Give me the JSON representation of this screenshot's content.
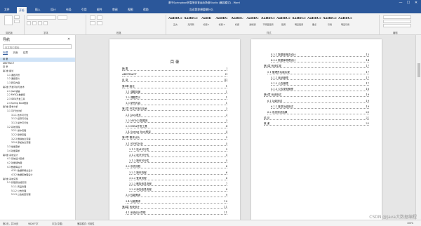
{
  "window": {
    "title": "基于Springboot的智慧体育运动场馆Studio (兼容模式) - Word",
    "controls": [
      "—",
      "☐",
      "✕"
    ]
  },
  "tabs": [
    "文件",
    "开始",
    "插入",
    "设计",
    "布局",
    "引用",
    "邮件",
    "审阅",
    "视图",
    "帮助"
  ],
  "tell_me": "告诉我你想要做什么",
  "ribbon": {
    "groups": [
      "剪贴板",
      "字体",
      "段落",
      "样式",
      "编辑"
    ],
    "styles": [
      {
        "sample": "AaBbCcI",
        "name": "正文"
      },
      {
        "sample": "AaBbCcI",
        "name": "无间隔"
      },
      {
        "sample": "AaBb",
        "name": "标题 1"
      },
      {
        "sample": "AaBbC",
        "name": "标题 2"
      },
      {
        "sample": "AaBbC",
        "name": "标题"
      },
      {
        "sample": "AaBbC",
        "name": "副标题"
      },
      {
        "sample": "AaBbCcD",
        "name": "不明显强调"
      },
      {
        "sample": "AaBbCcD",
        "name": "强调"
      },
      {
        "sample": "AaBbCcD",
        "name": "明显强调"
      },
      {
        "sample": "AaBbCcI",
        "name": "要点"
      },
      {
        "sample": "AaBbCcI",
        "name": "引用"
      },
      {
        "sample": "AaBbCcI",
        "name": "明显引用"
      }
    ]
  },
  "nav": {
    "title": "导航",
    "search_placeholder": "在文档中搜索",
    "tabs": [
      "标题",
      "页面",
      "结果"
    ],
    "items": [
      {
        "text": "摘 要",
        "indent": 0
      },
      {
        "text": "ABSTRACT",
        "indent": 0
      },
      {
        "text": "目 录",
        "indent": 0
      },
      {
        "text": "第1章 绪论",
        "indent": 0
      },
      {
        "text": "1.1 课题背景",
        "indent": 1
      },
      {
        "text": "1.2 课题意义",
        "indent": 1
      },
      {
        "text": "1.3 研究内容",
        "indent": 1
      },
      {
        "text": "第2章 开发环境与技术",
        "indent": 0
      },
      {
        "text": "2.1 Java语言",
        "indent": 1
      },
      {
        "text": "2.2 MYSQL数据库",
        "indent": 1
      },
      {
        "text": "2.3 IDEA开发工具",
        "indent": 1
      },
      {
        "text": "2.4 Spring Boot框架",
        "indent": 1
      },
      {
        "text": "第3章 需求分析",
        "indent": 0
      },
      {
        "text": "3.1 可行性分析",
        "indent": 1
      },
      {
        "text": "3.1.1 技术可行性",
        "indent": 2
      },
      {
        "text": "3.1.2 经济可行性",
        "indent": 2
      },
      {
        "text": "3.1.3 操作可行性",
        "indent": 2
      },
      {
        "text": "3.2 系统流程",
        "indent": 1
      },
      {
        "text": "3.2.1 操作流程",
        "indent": 2
      },
      {
        "text": "3.2.2 登录流程",
        "indent": 2
      },
      {
        "text": "3.2.3 删除信息流程",
        "indent": 2
      },
      {
        "text": "3.2.4 添加信息流程",
        "indent": 2
      },
      {
        "text": "3.3 性能需求",
        "indent": 1
      },
      {
        "text": "3.4 功能需求",
        "indent": 1
      },
      {
        "text": "第4章 系统设计",
        "indent": 0
      },
      {
        "text": "4.1 系统设计思想",
        "indent": 1
      },
      {
        "text": "4.2 功能结构图",
        "indent": 1
      },
      {
        "text": "4.3 数据库设计",
        "indent": 1
      },
      {
        "text": "4.3.1 数据库概念设计",
        "indent": 2
      },
      {
        "text": "4.3.2 数据库物理设计",
        "indent": 2
      },
      {
        "text": "第5章 系统实现",
        "indent": 0
      },
      {
        "text": "5.1 管理员功能实现",
        "indent": 1
      },
      {
        "text": "5.1.1 商品管理",
        "indent": 2
      },
      {
        "text": "5.1.2 公告管理",
        "indent": 2
      },
      {
        "text": "5.1.3 公告类型管理",
        "indent": 2
      }
    ]
  },
  "toc_left": {
    "title": "目 录",
    "lines": [
      {
        "text": "摘 要",
        "page": "I",
        "indent": 0
      },
      {
        "text": "ABSTRACT",
        "page": "II",
        "indent": 0
      },
      {
        "text": "目 录",
        "page": "III",
        "indent": 0
      },
      {
        "text": "第1章 绪论",
        "page": "1",
        "indent": 0
      },
      {
        "text": "1.1 课题背景",
        "page": "1",
        "indent": 1
      },
      {
        "text": "1.2 课题意义",
        "page": "1",
        "indent": 1
      },
      {
        "text": "1.3 研究内容",
        "page": "1",
        "indent": 1
      },
      {
        "text": "第2章 开发环境与技术",
        "page": "3",
        "indent": 0
      },
      {
        "text": "2.1 Java语言",
        "page": "3",
        "indent": 1
      },
      {
        "text": "2.2 MYSQL数据库",
        "page": "3",
        "indent": 1
      },
      {
        "text": "2.3 IDEA开发工具",
        "page": "4",
        "indent": 1
      },
      {
        "text": "2.4 Spring Boot框架",
        "page": "4",
        "indent": 1
      },
      {
        "text": "第3章 需求分析",
        "page": "5",
        "indent": 0
      },
      {
        "text": "3.1 可行性分析",
        "page": "5",
        "indent": 1
      },
      {
        "text": "3.1.1 技术可行性",
        "page": "5",
        "indent": 2
      },
      {
        "text": "3.1.2 经济可行性",
        "page": "5",
        "indent": 2
      },
      {
        "text": "3.1.3 操作可行性",
        "page": "5",
        "indent": 2
      },
      {
        "text": "3.2 系统流程",
        "page": "6",
        "indent": 1
      },
      {
        "text": "3.2.1 操作流程",
        "page": "6",
        "indent": 2
      },
      {
        "text": "3.2.2 登录流程",
        "page": "6",
        "indent": 2
      },
      {
        "text": "3.2.3 删除信息流程",
        "page": "7",
        "indent": 2
      },
      {
        "text": "3.2.4 添加信息流程",
        "page": "8",
        "indent": 2
      },
      {
        "text": "3.3 性能需求",
        "page": "9",
        "indent": 1
      },
      {
        "text": "3.4 功能需求",
        "page": "10",
        "indent": 1
      },
      {
        "text": "第4章 系统设计",
        "page": "11",
        "indent": 0
      },
      {
        "text": "4.1 系统设计思想",
        "page": "11",
        "indent": 1
      }
    ]
  },
  "toc_right": {
    "lines": [
      {
        "text": "4.3.1 数据库概念设计",
        "page": "13",
        "indent": 2
      },
      {
        "text": "4.3.2 数据库物理设计",
        "page": "14",
        "indent": 2
      },
      {
        "text": "第5章 系统实现",
        "page": "17",
        "indent": 0
      },
      {
        "text": "5.1 管理员功能实现",
        "page": "17",
        "indent": 1
      },
      {
        "text": "5.1.1 商品管理",
        "page": "17",
        "indent": 2
      },
      {
        "text": "5.1.2 公告管理",
        "page": "17",
        "indent": 2
      },
      {
        "text": "5.1.3 公告类型管理",
        "page": "18",
        "indent": 2
      },
      {
        "text": "第6章 系统测试",
        "page": "19",
        "indent": 0
      },
      {
        "text": "6.1 功能测试",
        "page": "19",
        "indent": 1
      },
      {
        "text": "6.1.1 登录功能测试",
        "page": "19",
        "indent": 2
      },
      {
        "text": "6.2 系统测试结果",
        "page": "20",
        "indent": 1
      },
      {
        "text": "结 论",
        "page": "21",
        "indent": 0
      },
      {
        "text": "致 谢",
        "page": "22",
        "indent": 0
      }
    ]
  },
  "status": {
    "page": "第2页，共36页",
    "words": "9826个字",
    "lang": "中文(中国)",
    "mode": "兼容模式: 可用性",
    "zoom": "100%"
  },
  "watermark": "CSDN @Java大数据编程"
}
